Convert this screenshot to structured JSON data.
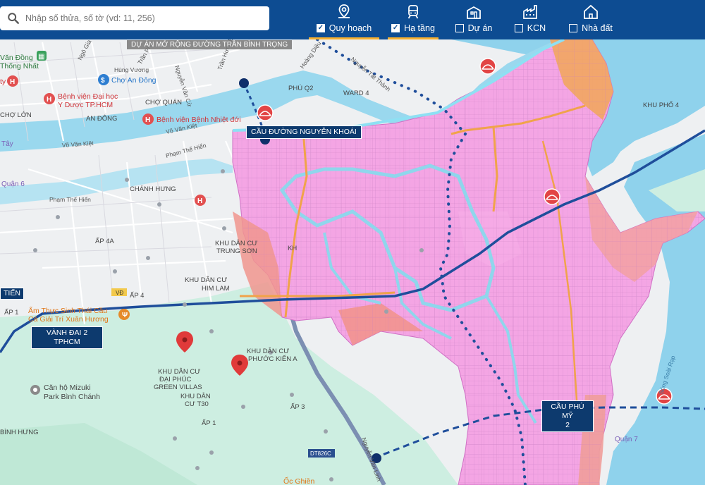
{
  "search": {
    "placeholder": "Nhập số thửa, số tờ (vd: 11, 256)"
  },
  "tabs": [
    {
      "label": "Quy hoạch",
      "checked": true,
      "active": true,
      "icon": "map-pin-icon"
    },
    {
      "label": "Hạ tầng",
      "checked": true,
      "active": true,
      "icon": "train-icon"
    },
    {
      "label": "Dự án",
      "checked": false,
      "active": false,
      "icon": "building-icon"
    },
    {
      "label": "KCN",
      "checked": false,
      "active": false,
      "icon": "factory-icon"
    },
    {
      "label": "Nhà đất",
      "checked": false,
      "active": false,
      "icon": "house-icon"
    }
  ],
  "colors": {
    "topbar": "#0d4c92",
    "tab_underline": "#f6b031",
    "planning_pink": "#f5a0e6",
    "planning_orange": "#f3a063",
    "water": "#9ad8ee",
    "greenland": "#c9ecdf",
    "infra_line": "#1f4e9b",
    "marker_red": "#e03a3a"
  },
  "map": {
    "project_banner": "DỰ ÁN MỞ RỘNG ĐƯỜNG TRẦN BÌNH TRỌNG",
    "signs": {
      "cau_nguyen_khoai": "CẦU ĐƯỜNG NGUYỄN KHOÁI",
      "vanh_dai_line1": "VÀNH ĐAI 2",
      "vanh_dai_line2": "TPHCM",
      "cau_phu_my_line1": "CẦU PHÚ MỸ",
      "cau_phu_my_line2": "2",
      "tien": "TIẾN"
    },
    "areas": {
      "phu_q2": "PHÚ Q2",
      "ward4": "WARD 4",
      "khu_pho_4": "KHU PHỐ 4",
      "khu_dan_cu_trung_son_1": "KHU DÂN CƯ",
      "khu_dan_cu_trung_son_2": "TRUNG SƠN",
      "khu_dan_cu_him_lam_1": "KHU DÂN CƯ",
      "khu_dan_cu_him_lam_2": "HIM LAM",
      "khu_dan_cu_phuoc_kien_1": "KHU DÂN CƯ",
      "khu_dan_cu_phuoc_kien_2": "PHƯỚC KIỂN A",
      "dai_phuc_1": "KHU DÂN CƯ",
      "dai_phuc_2": "ĐẠI PHÚC",
      "dai_phuc_3": "GREEN VILLAS",
      "t30_1": "KHU DÂN",
      "t30_2": "CƯ T30",
      "ap_4a": "ẤP 4A",
      "ap_4": "ẤP 4",
      "ap_1_left": "ẤP 1",
      "ap_3": "ẤP 3",
      "ap_1_mid": "ẤP 1",
      "chanh_hung": "CHÁNH HƯNG",
      "an_dong": "AN ĐÔNG",
      "cho_quan": "CHỢ QUÁN",
      "cho_lon": "CHỢ LỚN",
      "binh_hung": "BÌNH HƯNG",
      "quan6": "Quận 6",
      "quan7": "Quận 7",
      "tay": "Tây"
    },
    "pois": {
      "cho_an_dong": "Chợ An Đông",
      "bv_dh_1": "Bệnh viện Đại học",
      "bv_dh_2": "Y Dược TP.HCM",
      "bv_nhiet_doi": "Bệnh viện Bệnh Nhiệt đới",
      "an_thuc_1": "Ẩm Thực Sinh Thái Cầu",
      "an_thuc_2": "Cá Giải Trí Xuân Hương",
      "mizuki_1": "Căn hộ Mizuki",
      "mizuki_2": "Park Bình Chánh",
      "oc_ghien": "Ốc Ghiền",
      "dong_nhat_1": "Văn Đồng",
      "dong_nhat_2": "Thống Nhất",
      "ty": "ty"
    },
    "roads": {
      "ngo_gia_tu": "Ngô Gia Tự",
      "hung_vuong": "Hùng Vương",
      "tran_phu": "Trần Phú",
      "nguyen_van_cu": "Nguyễn Văn Cừ",
      "vo_van_kiet_1": "Võ Văn Kiệt",
      "vo_van_kiet_2": "Võ Văn Kiệt",
      "pham_the_hien_1": "Phạm Thế Hiển",
      "pham_the_hien_2": "Phạm Thế Hiển",
      "hoang_dieu": "Hoàng Diệu",
      "nguyen_tat_thanh": "Nguyễn Tất Thành",
      "tran_hung_dao": "Trần Hưng Đạo",
      "song_soai_rap": "Sông Soài Rạp",
      "nguyen_van_linh": "Nguyễn Văn Linh",
      "dt826c": "DT826C",
      "vd": "VĐ",
      "kh": "KH"
    }
  }
}
